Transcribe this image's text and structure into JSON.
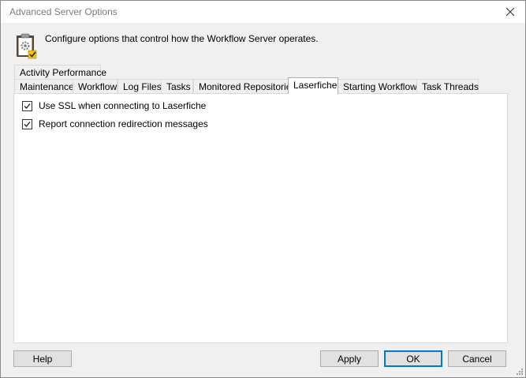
{
  "window": {
    "title": "Advanced Server Options"
  },
  "header": {
    "description": "Configure options that control how the Workflow Server operates."
  },
  "tabs": {
    "row1": [
      {
        "label": "Activity Performance"
      }
    ],
    "row2": [
      {
        "label": "Maintenance"
      },
      {
        "label": "Workflow"
      },
      {
        "label": "Log Files"
      },
      {
        "label": "Tasks"
      },
      {
        "label": "Monitored Repositories"
      },
      {
        "label": "Laserfiche"
      },
      {
        "label": "Starting Workflows"
      },
      {
        "label": "Task Threads"
      }
    ],
    "active": "Laserfiche"
  },
  "options": [
    {
      "label": "Use SSL when connecting to Laserfiche",
      "checked": true
    },
    {
      "label": "Report connection redirection messages",
      "checked": true
    }
  ],
  "buttons": {
    "help": "Help",
    "apply": "Apply",
    "ok": "OK",
    "cancel": "Cancel"
  },
  "colors": {
    "accent": "#0078d7",
    "button_face": "#e1e1e1",
    "window_bg": "#f0f0f0"
  }
}
